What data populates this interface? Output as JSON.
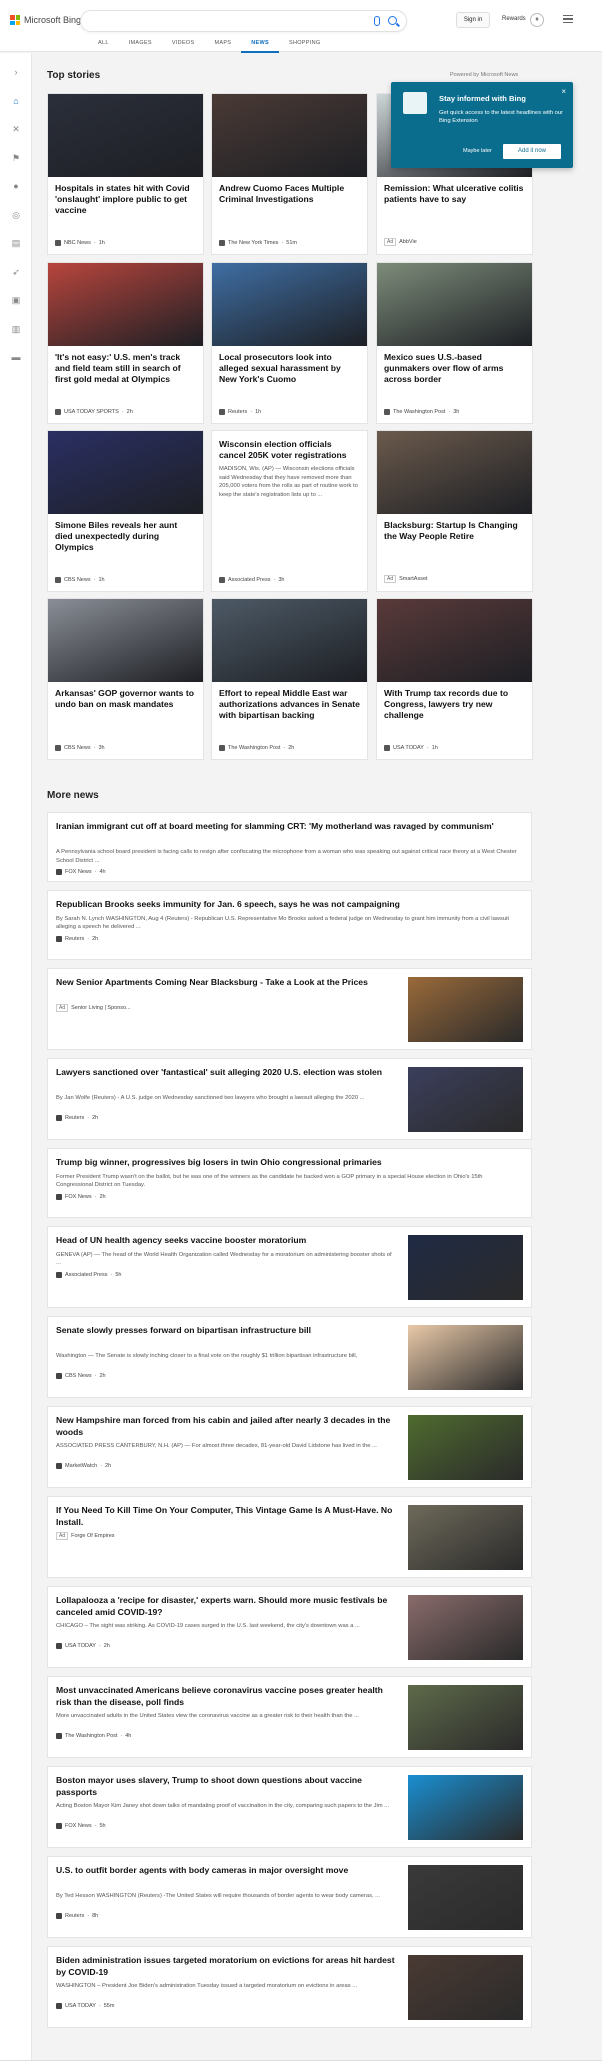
{
  "header": {
    "brand": "Microsoft Bing",
    "tabs": [
      "ALL",
      "IMAGES",
      "VIDEOS",
      "MAPS",
      "NEWS",
      "SHOPPING"
    ],
    "active_tab": "NEWS",
    "signin_label": "Sign in",
    "rewards_label": "Rewards"
  },
  "rail_icons": [
    "chevron-right-icon",
    "home-icon",
    "tools-icon",
    "flag-icon",
    "location-icon",
    "globe-icon",
    "chart-icon",
    "rocket-icon",
    "film-icon",
    "bank-icon",
    "card-icon"
  ],
  "top_stories": {
    "title": "Top stories",
    "powered_by": "Powered by Microsoft News",
    "cards": [
      {
        "title": "Hospitals in states hit with Covid 'onslaught' implore public to get vaccine",
        "source": "NBC News",
        "time": "1h",
        "color": "#2b2f3a"
      },
      {
        "title": "Andrew Cuomo Faces Multiple Criminal Investigations",
        "source": "The New York Times",
        "time": "51m",
        "color": "#4a3a35"
      },
      {
        "title": "Remission: What ulcerative colitis patients have to say",
        "source": "AbbVie",
        "ad": "Ad",
        "color": "#cfd7d9"
      },
      {
        "title": "'It's not easy:' U.S. men's track and field team still in search of first gold medal at Olympics",
        "source": "USA TODAY SPORTS",
        "time": "2h",
        "color": "#b8453d"
      },
      {
        "title": "Local prosecutors look into alleged sexual harassment by New York's Cuomo",
        "source": "Reuters",
        "time": "1h",
        "color": "#3f6ea3"
      },
      {
        "title": "Mexico sues U.S.-based gunmakers over flow of arms across border",
        "source": "The Washington Post",
        "time": "3h",
        "color": "#7d8c7a"
      },
      {
        "title": "Simone Biles reveals her aunt died unexpectedly during Olympics",
        "source": "CBS News",
        "time": "1h",
        "color": "#2a2f63"
      },
      {
        "title": "Wisconsin election officials cancel 205K voter registrations",
        "snippet": "MADISON, Wis. (AP) — Wisconsin elections officials said Wednesday that they have removed more than 205,000 voters from the rolls as part of routine work to keep the state's registration lists up to ...",
        "source": "Associated Press",
        "time": "3h"
      },
      {
        "title": "Blacksburg: Startup Is Changing the Way People Retire",
        "source": "SmartAsset",
        "ad": "Ad",
        "color": "#6b5a4c"
      },
      {
        "title": "Arkansas' GOP governor wants to undo ban on mask mandates",
        "source": "CBS News",
        "time": "3h",
        "color": "#8a8e96"
      },
      {
        "title": "Effort to repeal Middle East war authorizations advances in Senate with bipartisan backing",
        "source": "The Washington Post",
        "time": "2h",
        "color": "#4d5a66"
      },
      {
        "title": "With Trump tax records due to Congress, lawyers try new challenge",
        "source": "USA TODAY",
        "time": "1h",
        "color": "#5a3a3a"
      }
    ]
  },
  "popup": {
    "title": "Stay informed with Bing",
    "desc": "Get quick access to the latest headlines with our Bing Extension",
    "later": "Maybe later",
    "add": "Add it now"
  },
  "more_news": {
    "title": "More news",
    "items": [
      {
        "title": "Iranian immigrant cut off at board meeting for slamming CRT: 'My motherland was ravaged by communism'",
        "snippet": "A Pennsylvania school board president is facing calls to resign after confiscating the microphone from a woman who was speaking out against critical race theory at a West Chester School District ...",
        "source": "FOX News",
        "time": "4h"
      },
      {
        "title": "Republican Brooks seeks immunity for Jan. 6 speech, says he was not campaigning",
        "snippet": "By Sarah N. Lynch WASHINGTON, Aug 4 (Reuters) - Republican U.S. Representative Mo Brooks asked a federal judge on Wednesday to grant him immunity from a civil lawsuit alleging a speech he delivered ...",
        "source": "Reuters",
        "time": "2h"
      },
      {
        "title": "New Senior Apartments Coming Near Blacksburg - Take a Look at the Prices",
        "source": "Senior Living | Sponso...",
        "ad": "Ad",
        "color": "#9a6a3a"
      },
      {
        "title": "Lawyers sanctioned over 'fantastical' suit alleging 2020 U.S. election was stolen",
        "snippet": "By Jan Wolfe (Reuters) - A U.S. judge on Wednesday sanctioned two lawyers who brought a lawsuit alleging the 2020 ...",
        "source": "Reuters",
        "time": "2h",
        "color": "#3b3f5c"
      },
      {
        "title": "Trump big winner, progressives big losers in twin Ohio congressional primaries",
        "snippet": "Former President Trump wasn't on the ballot, but he was one of the winners as the candidate he backed won a GOP primary in a special House election in Ohio's 15th Congressional District on Tuesday.",
        "source": "FOX News",
        "time": "2h"
      },
      {
        "title": "Head of UN health agency seeks vaccine booster moratorium",
        "snippet": "GENEVA (AP) — The head of the World Health Organization called Wednesday for a moratorium on administering booster shots of ...",
        "source": "Associated Press",
        "time": "5h",
        "color": "#1f2a44"
      },
      {
        "title": "Senate slowly presses forward on bipartisan infrastructure bill",
        "snippet": "Washington — The Senate is slowly inching closer to a final vote on the roughly $1 trillion bipartisan infrastructure bill,",
        "source": "CBS News",
        "time": "2h",
        "color": "#e9c9a8"
      },
      {
        "title": "New Hampshire man forced from his cabin and jailed after nearly 3 decades in the woods",
        "snippet": "ASSOCIATED PRESS CANTERBURY, N.H. (AP) — For almost three decades, 81-year-old David Lidstone has lived in the ...",
        "source": "MarketWatch",
        "time": "2h",
        "color": "#4f6b2f"
      },
      {
        "title": "If You Need To Kill Time On Your Computer, This Vintage Game Is A Must-Have. No Install.",
        "source": "Forge Of Empires",
        "ad": "Ad",
        "color": "#6e6a5a"
      },
      {
        "title": "Lollapalooza a 'recipe for disaster,' experts warn. Should more music festivals be canceled amid COVID-19?",
        "snippet": "CHICAGO – The sight was striking. As COVID-19 cases surged in the U.S. last weekend, the city's downtown was a ...",
        "source": "USA TODAY",
        "time": "2h",
        "color": "#8a6b6b"
      },
      {
        "title": "Most unvaccinated Americans believe coronavirus vaccine poses greater health risk than the disease, poll finds",
        "snippet": "More unvaccinated adults in the United States view the coronavirus vaccine as a greater risk to their health than the ...",
        "source": "The Washington Post",
        "time": "4h",
        "color": "#5e6a4a"
      },
      {
        "title": "Boston mayor uses slavery, Trump to shoot down questions about vaccine passports",
        "snippet": "Acting Boston Mayor Kim Janey shot down talks of mandating proof of vaccination in the city, comparing such papers to the Jim ...",
        "source": "FOX News",
        "time": "5h",
        "color": "#1a8fd1"
      },
      {
        "title": "U.S. to outfit border agents with body cameras in major oversight move",
        "snippet": "By Ted Hesson WASHINGTON (Reuters) -The United States will require thousands of border agents to wear body cameras, ...",
        "source": "Reuters",
        "time": "8h",
        "color": "#3a3a3a"
      },
      {
        "title": "Biden administration issues targeted moratorium on evictions for areas hit hardest by COVID-19",
        "snippet": "WASHINGTON – President Joe Biden's administration Tuesday issued a targeted moratorium on evictions in areas ...",
        "source": "USA TODAY",
        "time": "55m",
        "color": "#4a3a33"
      }
    ]
  },
  "colors": {
    "accent": "#106ebe",
    "popup": "#0a6d8e"
  }
}
